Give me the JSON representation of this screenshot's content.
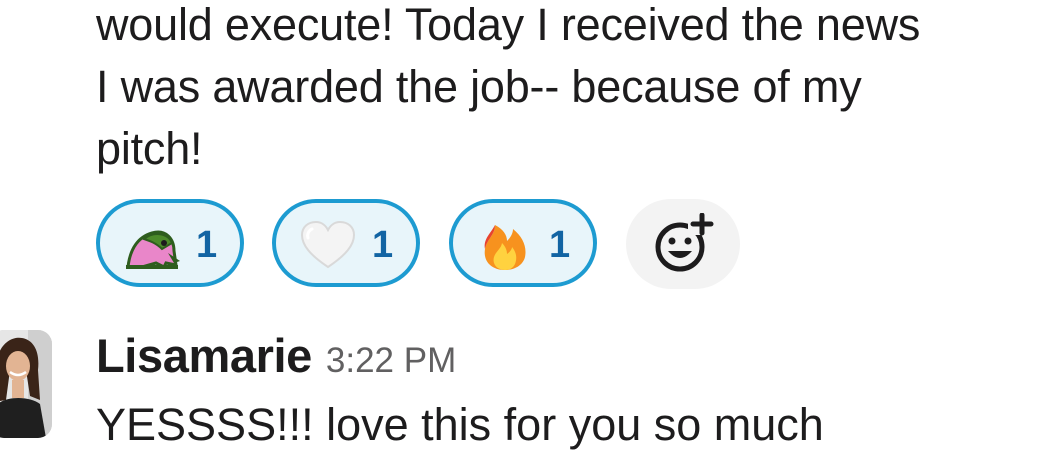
{
  "message": {
    "lines": [
      "would execute! Today I received the news",
      "I was awarded the job-- because of my",
      "pitch!"
    ]
  },
  "reactions": [
    {
      "icon": "party-blob-icon",
      "count": "1"
    },
    {
      "icon": "white-heart-icon",
      "count": "1"
    },
    {
      "icon": "fire-icon",
      "count": "1"
    }
  ],
  "add_reaction": {
    "icon": "add-emoji-icon"
  },
  "reply": {
    "sender": "Lisamarie",
    "time": "3:22 PM",
    "text": "YESSSS!!! love this for you so much"
  },
  "colors": {
    "reaction_border": "#1d9bd1",
    "reaction_bg": "#e8f5fa",
    "reaction_count": "#1264a3",
    "timestamp": "#616061"
  }
}
